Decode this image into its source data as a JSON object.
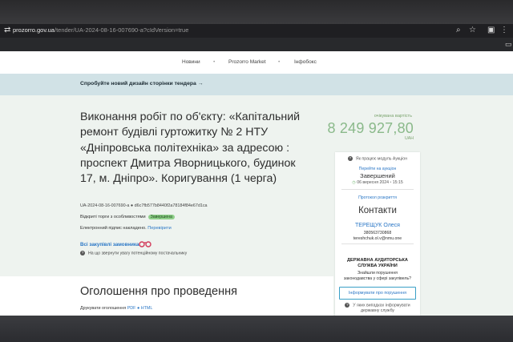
{
  "browser": {
    "url_domain": "prozorro.gov.ua",
    "url_rest": "/tender/UA-2024-08-16-007690-a?cIdVersion=true"
  },
  "nav": {
    "items": [
      "Новини",
      "Prozorro Market",
      "Інфобокс"
    ]
  },
  "promo": {
    "text": "Спробуйте новий дизайн сторінки тендера →"
  },
  "tender": {
    "title": "Виконання робіт по об'єкту: «Капітальний ремонт будівлі гуртожитку № 2 НТУ «Дніпровська політехніка» за адресою : проспект Дмитра Яворницького, будинок 17, м. Дніпро». Коригування (1 черга)",
    "id_line": "UA-2024-08-16-007690-a ● d6c7fb577b8440f2a78184f84e67d1ca",
    "procedure_label": "Відкриті торги з особливостями",
    "status_badge": "Завершена",
    "signature_label": "Електронний підпис накладено.",
    "signature_link": "Перевірити",
    "buyer_link": "Всі закупівлі замовника",
    "note": "На що звернути увагу потенційному постачальнику"
  },
  "price": {
    "label": "очікувана вартість",
    "value": "8 249 927,80",
    "currency": "UAH"
  },
  "card": {
    "auction_question": "Як працює модуль Аукціон",
    "auction_link": "Перейти на аукціон",
    "auction_status": "Завершений",
    "auction_date": "06 вересня 2024",
    "auction_time": "15:15",
    "protocol_link": "Протокол розкриття",
    "contacts_title": "Контакти",
    "contact_name": "ТЕРЕЩУК Олеся",
    "contact_phone": "380563730868",
    "contact_email": "tereshchuk.ol.v@nmu.one",
    "audit_title_1": "ДЕРЖАВНА АУДИТОРСЬКА",
    "audit_title_2": "СЛУЖБА УКРАЇНИ",
    "audit_q_1": "Знайшли порушення",
    "audit_q_2": "законодавства у сфері закупівель?",
    "report_button": "Інформувати про порушення",
    "footnote_1": "У яких випадках інформувати",
    "footnote_2": "державну службу"
  },
  "section": {
    "title": "Оголошення про проведення",
    "print_label": "Друкувати оголошення",
    "pdf": "PDF",
    "html": "HTML"
  }
}
